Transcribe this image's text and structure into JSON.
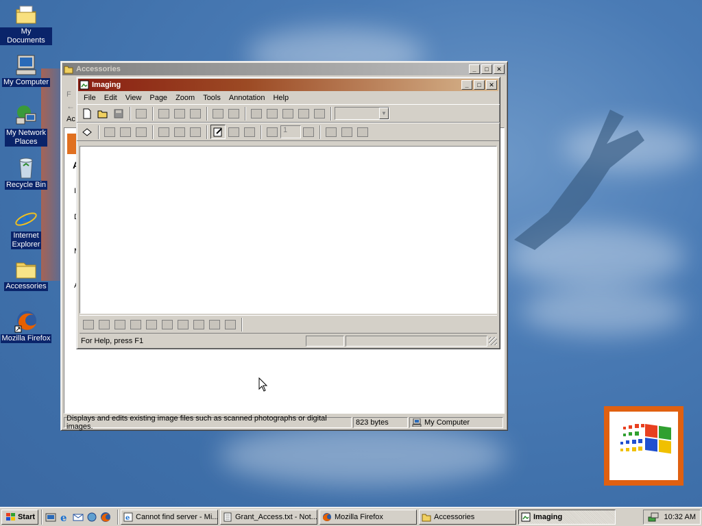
{
  "desktop": {
    "icons": [
      {
        "label": "My Documents"
      },
      {
        "label": "My Computer"
      },
      {
        "label_line1": "My Network",
        "label_line2": "Places"
      },
      {
        "label": "Recycle Bin"
      },
      {
        "label_line1": "Internet",
        "label_line2": "Explorer"
      },
      {
        "label": "Accessories"
      },
      {
        "label": "Mozilla Firefox"
      }
    ]
  },
  "accessories_window": {
    "title": "Accessories",
    "status": {
      "description": "Displays and edits existing image files such as scanned photographs or digital images.",
      "size": "823 bytes",
      "location": "My Computer"
    }
  },
  "imaging_window": {
    "title": "Imaging",
    "menu": [
      "File",
      "Edit",
      "View",
      "Page",
      "Zoom",
      "Tools",
      "Annotation",
      "Help"
    ],
    "page_field": "1",
    "status_help": "For Help, press F1"
  },
  "taskbar": {
    "start_label": "Start",
    "tasks": [
      {
        "label": "Cannot find server - Mi..."
      },
      {
        "label": "Grant_Access.txt - Not..."
      },
      {
        "label": "Mozilla Firefox"
      },
      {
        "label": "Accessories"
      },
      {
        "label": "Imaging"
      }
    ],
    "clock": "10:32 AM"
  },
  "colors": {
    "active_title_start": "#0a246a",
    "active_title_end": "#a6caf0",
    "inactive_title_start": "#808080",
    "window_face": "#d4d0c8",
    "selection_blue": "#0a246a"
  }
}
